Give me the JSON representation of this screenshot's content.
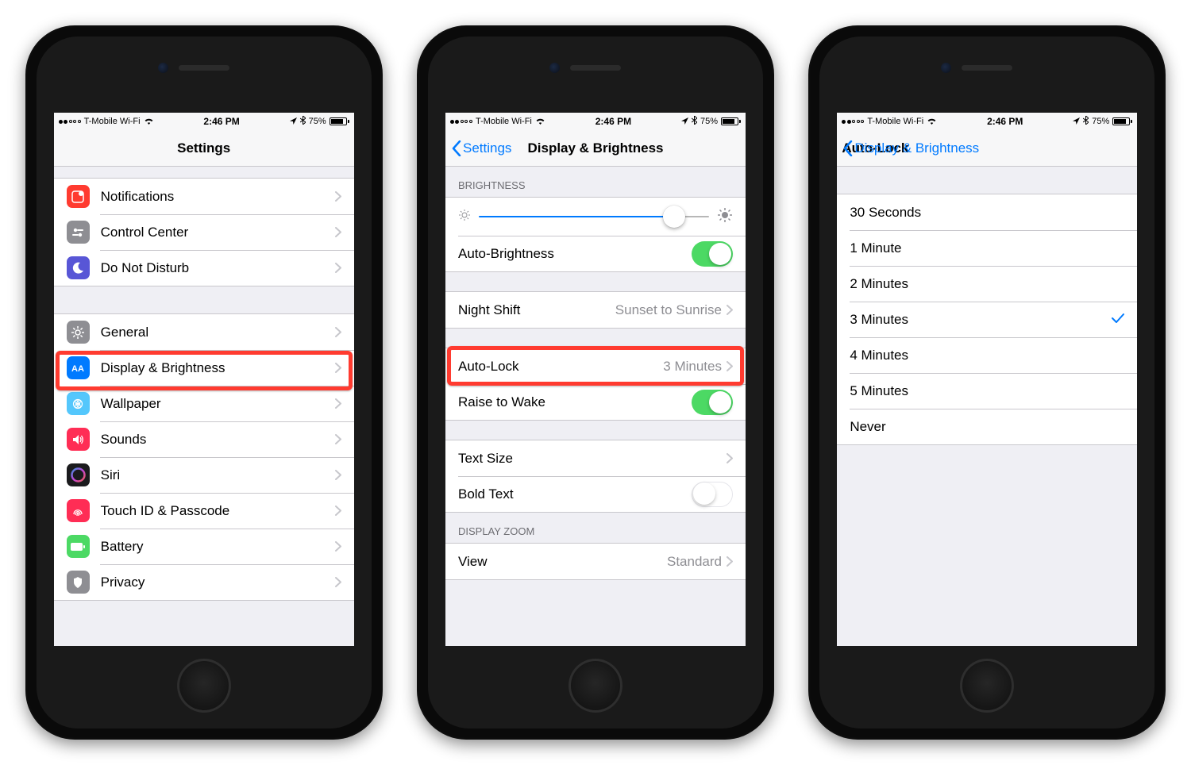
{
  "status_bar": {
    "carrier": "T-Mobile Wi-Fi",
    "time": "2:46 PM",
    "battery_pct": "75%"
  },
  "phone1": {
    "nav_title": "Settings",
    "group1": [
      {
        "label": "Notifications",
        "icon": "notifications",
        "bg": "#ff3b30"
      },
      {
        "label": "Control Center",
        "icon": "control",
        "bg": "#8e8e93"
      },
      {
        "label": "Do Not Disturb",
        "icon": "dnd",
        "bg": "#5856d6"
      }
    ],
    "group2": [
      {
        "label": "General",
        "icon": "gear",
        "bg": "#8e8e93"
      },
      {
        "label": "Display & Brightness",
        "icon": "display",
        "bg": "#007aff"
      },
      {
        "label": "Wallpaper",
        "icon": "wallpaper",
        "bg": "#54c7fc"
      },
      {
        "label": "Sounds",
        "icon": "sounds",
        "bg": "#ff2d55"
      },
      {
        "label": "Siri",
        "icon": "siri",
        "bg": "#1b1b1d"
      },
      {
        "label": "Touch ID & Passcode",
        "icon": "touchid",
        "bg": "#ff2d55"
      },
      {
        "label": "Battery",
        "icon": "battery",
        "bg": "#4cd964"
      },
      {
        "label": "Privacy",
        "icon": "privacy",
        "bg": "#8e8e93"
      }
    ]
  },
  "phone2": {
    "back_label": "Settings",
    "nav_title": "Display & Brightness",
    "section_brightness": "BRIGHTNESS",
    "auto_brightness": "Auto-Brightness",
    "night_shift_label": "Night Shift",
    "night_shift_value": "Sunset to Sunrise",
    "auto_lock_label": "Auto-Lock",
    "auto_lock_value": "3 Minutes",
    "raise_to_wake": "Raise to Wake",
    "text_size": "Text Size",
    "bold_text": "Bold Text",
    "section_zoom": "DISPLAY ZOOM",
    "view_label": "View",
    "view_value": "Standard"
  },
  "phone3": {
    "back_label": "Display & Brightness",
    "nav_title": "Auto-Lock",
    "options": [
      "30 Seconds",
      "1 Minute",
      "2 Minutes",
      "3 Minutes",
      "4 Minutes",
      "5 Minutes",
      "Never"
    ],
    "selected_index": 3
  }
}
